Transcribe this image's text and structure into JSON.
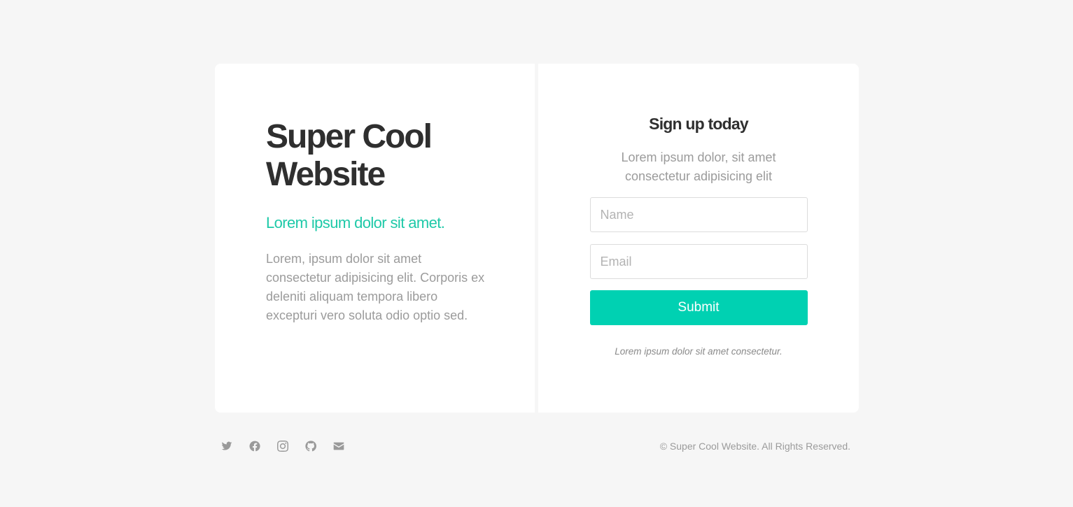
{
  "hero": {
    "title": "Super Cool Website",
    "tagline": "Lorem ipsum dolor sit amet.",
    "description": "Lorem, ipsum dolor sit amet consectetur adipisicing elit. Corporis ex deleniti aliquam tempora libero excepturi vero soluta odio optio sed."
  },
  "signup": {
    "heading": "Sign up today",
    "subheading": "Lorem ipsum dolor, sit amet consectetur adipisicing elit",
    "name_placeholder": "Name",
    "email_placeholder": "Email",
    "submit_label": "Submit",
    "disclaimer": "Lorem ipsum dolor sit amet consectetur."
  },
  "footer": {
    "social_icons": [
      "twitter-icon",
      "facebook-icon",
      "instagram-icon",
      "github-icon",
      "envelope-icon"
    ],
    "copyright": "© Super Cool Website. All Rights Reserved."
  },
  "colors": {
    "accent": "#00d1b2",
    "tagline": "#1ec9a8",
    "heading": "#2f2f2f",
    "muted_text": "#9b9b9b",
    "background": "#f6f6f6"
  }
}
